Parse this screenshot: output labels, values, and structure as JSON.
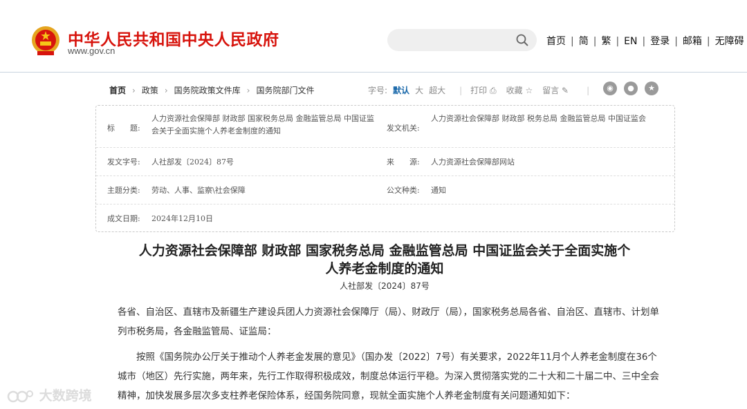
{
  "header": {
    "site_title": "中华人民共和国中央人民政府",
    "site_url": "www.gov.cn",
    "nav": [
      "首页",
      "简",
      "繁",
      "EN",
      "登录",
      "邮箱",
      "无障碍"
    ]
  },
  "breadcrumb": {
    "items": [
      "首页",
      "政策",
      "国务院政策文件库",
      "国务院部门文件"
    ]
  },
  "toolbar": {
    "font_label": "字号:",
    "font_sizes": [
      "默认",
      "大",
      "超大"
    ],
    "print_label": "打印",
    "favorite_label": "收藏",
    "comment_label": "留言"
  },
  "info": {
    "title_label": "标　　题:",
    "title_value": "人力资源社会保障部 财政部 国家税务总局 金融监管总局 中国证监会关于全面实施个人养老金制度的通知",
    "issuer_label": "发文机关:",
    "issuer_value": "人力资源社会保障部 财政部 税务总局 金融监管总局 中国证监会",
    "docno_label": "发文字号:",
    "docno_value": "人社部发〔2024〕87号",
    "source_label": "来　　源:",
    "source_value": "人力资源社会保障部网站",
    "category_label": "主题分类:",
    "category_value": "劳动、人事、监察\\社会保障",
    "type_label": "公文种类:",
    "type_value": "通知",
    "date_label": "成文日期:",
    "date_value": "2024年12月10日"
  },
  "article": {
    "title_line1": "人力资源社会保障部 财政部 国家税务总局 金融监管总局 中国证监会关于全面实施个",
    "title_line2": "人养老金制度的通知",
    "doc_number": "人社部发〔2024〕87号",
    "para1": "各省、自治区、直辖市及新疆生产建设兵团人力资源社会保障厅（局）、财政厅（局），国家税务总局各省、自治区、直辖市、计划单列市税务局，各金融监管局、证监局：",
    "para2": "按照《国务院办公厅关于推动个人养老金发展的意见》（国办发〔2022〕7号）有关要求，2022年11月个人养老金制度在36个城市（地区）先行实施，两年来，先行工作取得积极成效，制度总体运行平稳。为深入贯彻落实党的二十大和二十届二中、三中全会精神，加快发展多层次多支柱养老保险体系，经国务院同意，现就全面实施个人养老金制度有关问题通知如下："
  },
  "watermark": {
    "text": "大数跨境"
  },
  "colors": {
    "brand_red": "#d7140d",
    "accent_blue": "#1565a8"
  }
}
